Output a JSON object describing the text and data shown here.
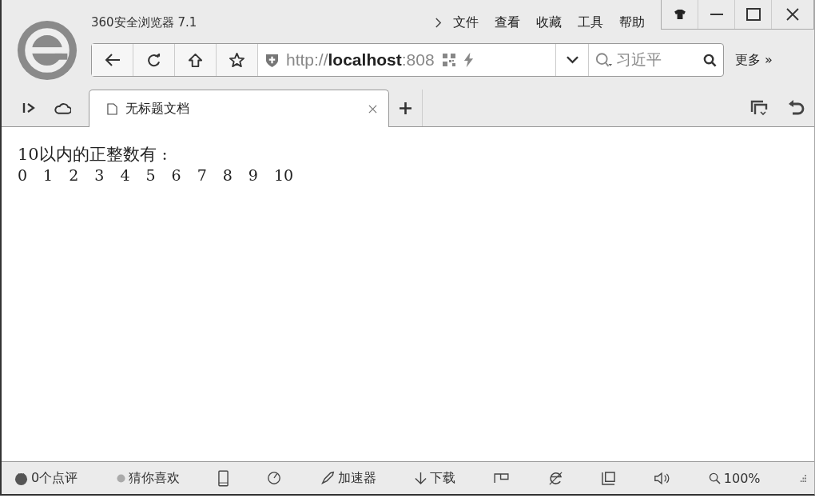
{
  "window": {
    "title": "360安全浏览器 7.1"
  },
  "menu": [
    {
      "label": "文件"
    },
    {
      "label": "查看"
    },
    {
      "label": "收藏"
    },
    {
      "label": "工具"
    },
    {
      "label": "帮助"
    }
  ],
  "address": {
    "scheme": "http://",
    "host": "localhost",
    "port": ":808"
  },
  "search": {
    "value": "习近平"
  },
  "more": "更多 »",
  "tabs": [
    {
      "label": "无标题文档",
      "selected": true
    }
  ],
  "page": {
    "heading": "10以内的正整数有 :",
    "numbers": [
      "0",
      "1",
      "2",
      "3",
      "4",
      "5",
      "6",
      "7",
      "8",
      "9",
      "10"
    ]
  },
  "status_bar": {
    "reviews": "0个点评",
    "guess": "猜你喜欢",
    "accelerator": "加速器",
    "download": "下载",
    "zoom": "100%"
  }
}
